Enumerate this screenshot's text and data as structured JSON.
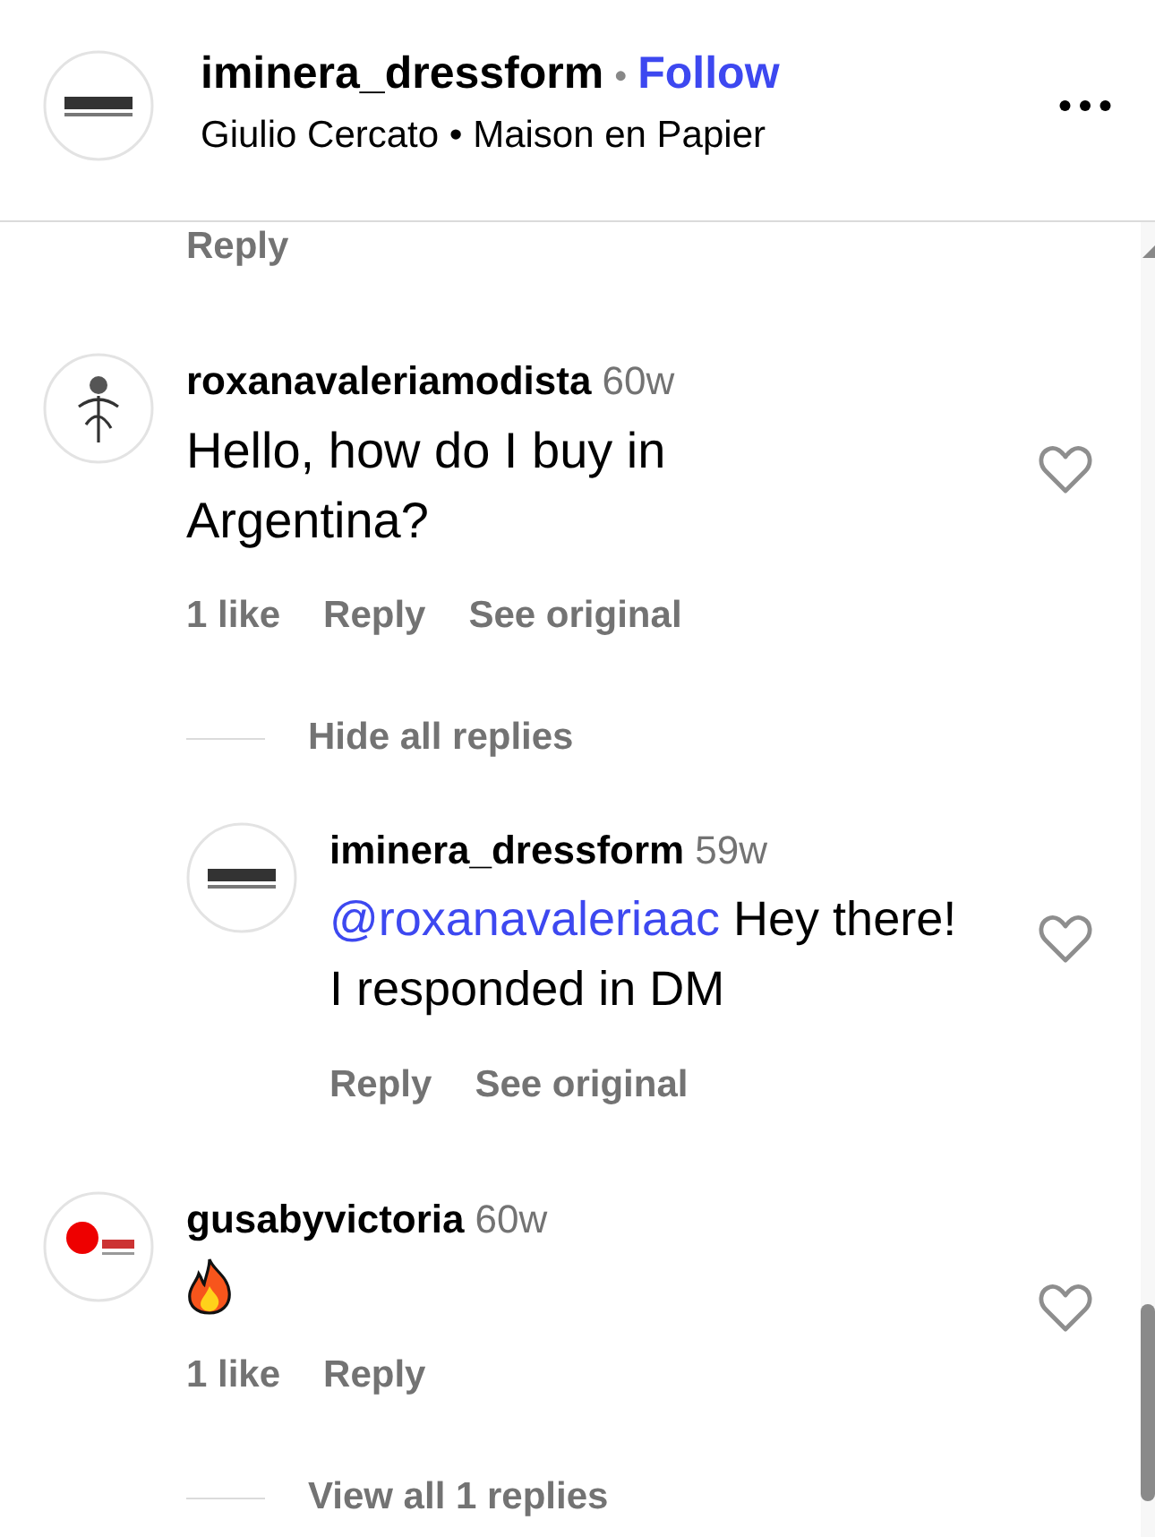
{
  "header": {
    "username": "iminera_dressform",
    "separator": "•",
    "follow": "Follow",
    "subtitle": "Giulio Cercato • Maison en Papier"
  },
  "partial_reply": "Reply",
  "comments": [
    {
      "kind": "text",
      "username": "roxanavaleriamodista",
      "time": "60w",
      "text": "Hello, how do I buy in Argentina?",
      "actions": [
        "1 like",
        "Reply",
        "See original"
      ],
      "replies_toggle": "Hide all replies",
      "replies": [
        {
          "username": "iminera_dressform",
          "time": "59w",
          "mention": "@roxanavaleriaac",
          "text": "Hey there! I responded in DM",
          "actions": [
            "Reply",
            "See original"
          ]
        }
      ]
    },
    {
      "kind": "emoji",
      "username": "gusabyvictoria",
      "time": "60w",
      "actions": [
        "1 like",
        "Reply"
      ],
      "replies_toggle": "View all 1 replies"
    }
  ]
}
